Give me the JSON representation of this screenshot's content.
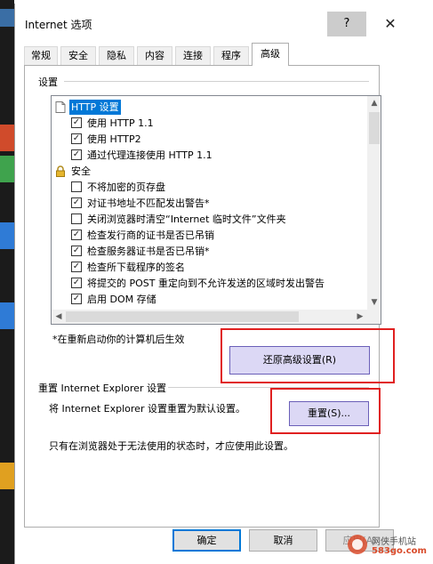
{
  "window": {
    "title": "Internet 选项",
    "help_label": "?",
    "close_label": "✕"
  },
  "tabs": [
    {
      "label": "常规"
    },
    {
      "label": "安全"
    },
    {
      "label": "隐私"
    },
    {
      "label": "内容"
    },
    {
      "label": "连接"
    },
    {
      "label": "程序"
    },
    {
      "label": "高级",
      "active": true
    }
  ],
  "settings": {
    "group_label": "设置",
    "items": [
      {
        "text": "HTTP 设置",
        "kind": "category",
        "icon": "page-icon",
        "selected": true
      },
      {
        "text": "使用 HTTP 1.1",
        "kind": "checkbox",
        "checked": true
      },
      {
        "text": "使用 HTTP2",
        "kind": "checkbox",
        "checked": true
      },
      {
        "text": "通过代理连接使用 HTTP 1.1",
        "kind": "checkbox",
        "checked": true
      },
      {
        "text": "安全",
        "kind": "category",
        "icon": "lock-icon"
      },
      {
        "text": "不将加密的页存盘",
        "kind": "checkbox",
        "checked": false
      },
      {
        "text": "对证书地址不匹配发出警告*",
        "kind": "checkbox",
        "checked": true
      },
      {
        "text": "关闭浏览器时清空“Internet 临时文件”文件夹",
        "kind": "checkbox",
        "checked": false
      },
      {
        "text": "检查发行商的证书是否已吊销",
        "kind": "checkbox",
        "checked": true
      },
      {
        "text": "检查服务器证书是否已吊销*",
        "kind": "checkbox",
        "checked": true
      },
      {
        "text": "检查所下载程序的签名",
        "kind": "checkbox",
        "checked": true
      },
      {
        "text": "将提交的 POST 重定向到不允许发送的区域时发出警告",
        "kind": "checkbox",
        "checked": true
      },
      {
        "text": "启用 DOM 存储",
        "kind": "checkbox",
        "checked": true
      }
    ],
    "restart_note": "*在重新启动你的计算机后生效",
    "restore_button": "还原高级设置(R)"
  },
  "reset": {
    "group_label": "重置 Internet Explorer 设置",
    "description": "将 Internet Explorer 设置重置为默认设置。",
    "reset_button": "重置(S)...",
    "warning": "只有在浏览器处于无法使用的状态时，才应使用此设置。"
  },
  "footer": {
    "ok": "确定",
    "cancel": "取消",
    "apply": "应用(A)"
  },
  "watermark": {
    "line1": "网侠手机站",
    "line2": "583go.com"
  },
  "colors": {
    "accent": "#0078d7",
    "highlight_box": "#e02020",
    "button_highlight": "#dcd8f5"
  }
}
